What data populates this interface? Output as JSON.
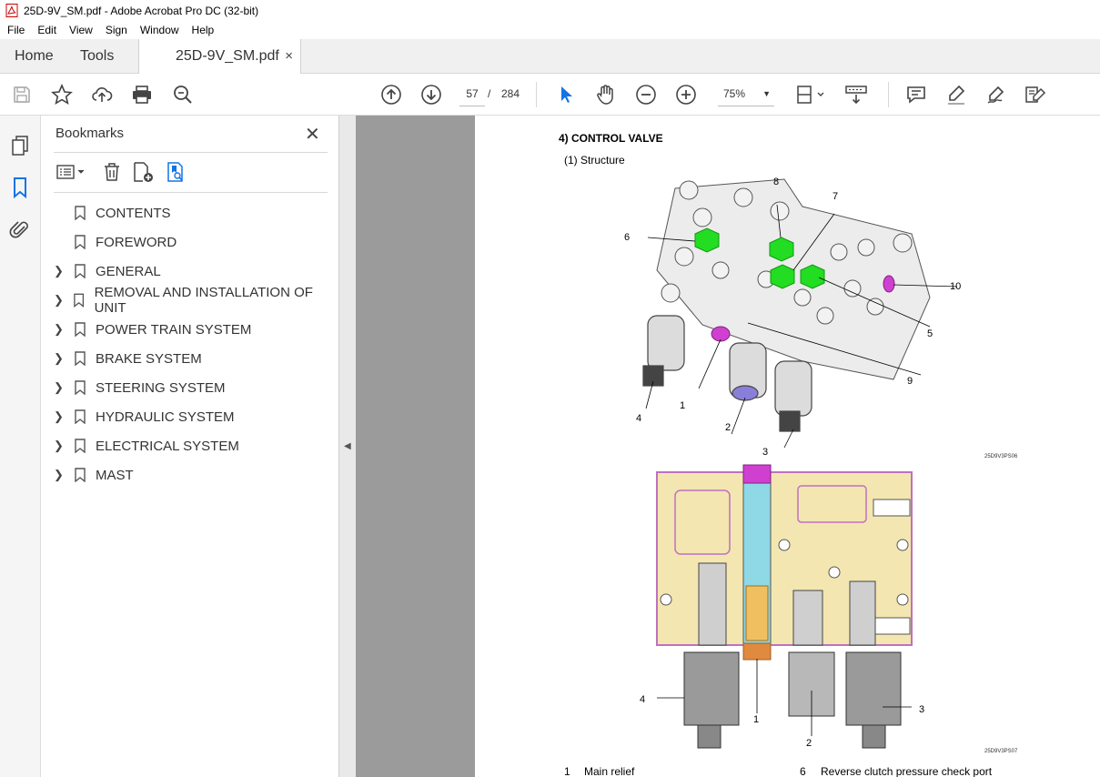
{
  "window": {
    "title": "25D-9V_SM.pdf - Adobe Acrobat Pro DC (32-bit)"
  },
  "menu": [
    "File",
    "Edit",
    "View",
    "Sign",
    "Window",
    "Help"
  ],
  "tabs": {
    "home": "Home",
    "tools": "Tools",
    "document": "25D-9V_SM.pdf",
    "close_glyph": "×"
  },
  "toolbar": {
    "current_page": "57",
    "page_separator": "/",
    "total_pages": "284",
    "zoom": "75%"
  },
  "sidebar": {
    "title": "Bookmarks",
    "items": [
      {
        "label": "CONTENTS",
        "expandable": false
      },
      {
        "label": "FOREWORD",
        "expandable": false
      },
      {
        "label": "GENERAL",
        "expandable": true
      },
      {
        "label": "REMOVAL AND INSTALLATION OF UNIT",
        "expandable": true
      },
      {
        "label": "POWER TRAIN SYSTEM",
        "expandable": true
      },
      {
        "label": "BRAKE SYSTEM",
        "expandable": true
      },
      {
        "label": "STEERING SYSTEM",
        "expandable": true
      },
      {
        "label": "HYDRAULIC SYSTEM",
        "expandable": true
      },
      {
        "label": "ELECTRICAL SYSTEM",
        "expandable": true
      },
      {
        "label": "MAST",
        "expandable": true
      }
    ]
  },
  "document": {
    "heading": "4) CONTROL VALVE",
    "subheading": "(1) Structure",
    "figure1_ref": "25D9V3PS06",
    "figure2_ref": "25D9V3PS07",
    "figure1_callouts": [
      "8",
      "7",
      "6",
      "10",
      "5",
      "9",
      "1",
      "4",
      "2",
      "3"
    ],
    "figure2_callouts": [
      "4",
      "1",
      "2",
      "3"
    ],
    "legend": [
      {
        "num": "1",
        "text": "Main relief"
      },
      {
        "num": "6",
        "text": "Reverse clutch pressure check port"
      }
    ]
  },
  "colors": {
    "accent_blue": "#1473e6",
    "valve_body": "#f3e6b0",
    "valve_outline": "#c070c0",
    "highlight_green": "#22dd22",
    "highlight_magenta": "#d040d0",
    "channel_cyan": "#8fd8e6"
  }
}
